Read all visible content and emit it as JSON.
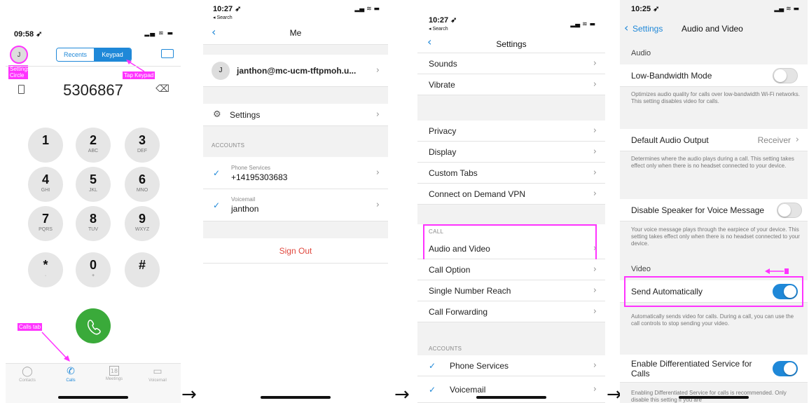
{
  "arrow_glyph": "→",
  "screen1": {
    "time": "09:58 ➶",
    "status_icons": "▂▄ ≋ ▬",
    "avatar_initial": "J",
    "tabs": [
      "Recents",
      "Keypad"
    ],
    "number": "5306867",
    "backspace": "⌫",
    "annotations": {
      "settings_circle": "Settings Circle",
      "tap_keypad": "Tap Keypad",
      "calls_tab": "Calls tab"
    },
    "keys": [
      {
        "d": "1",
        "l": ""
      },
      {
        "d": "2",
        "l": "ABC"
      },
      {
        "d": "3",
        "l": "DEF"
      },
      {
        "d": "4",
        "l": "GHI"
      },
      {
        "d": "5",
        "l": "JKL"
      },
      {
        "d": "6",
        "l": "MNO"
      },
      {
        "d": "7",
        "l": "PQRS"
      },
      {
        "d": "8",
        "l": "TUV"
      },
      {
        "d": "9",
        "l": "WXYZ"
      },
      {
        "d": "*",
        "l": "·"
      },
      {
        "d": "0",
        "l": "+"
      },
      {
        "d": "#",
        "l": ""
      }
    ],
    "bottom_tabs": [
      "Contacts",
      "Calls",
      "Meetings",
      "Voicemail"
    ],
    "meetings_date": "18",
    "colors": {
      "accent": "#1f88d8",
      "call_button": "#3aaa3a",
      "annotation": "#ff33ff"
    }
  },
  "screen2": {
    "time": "10:27 ➶",
    "back_to": "◂ Search",
    "status_icons": "▂▄ ≋ ▬",
    "title": "Me",
    "account_initial": "J",
    "account_email": "janthon@mc-ucm-tftpmoh.u...",
    "settings_label": "Settings",
    "accounts_header": "ACCOUNTS",
    "phone_services_label": "Phone Services",
    "phone_services_value": "+14195303683",
    "voicemail_label": "Voicemail",
    "voicemail_value": "janthon",
    "sign_out": "Sign Out"
  },
  "screen3": {
    "time": "10:27 ➶",
    "back_to": "◂ Search",
    "status_icons": "▂▄ ≋ ▬",
    "title": "Settings",
    "group1": [
      "Sounds",
      "Vibrate"
    ],
    "group2": [
      "Privacy",
      "Display",
      "Custom Tabs",
      "Connect on Demand VPN"
    ],
    "call_header": "CALL",
    "group3": [
      "Audio and Video",
      "Call Option",
      "Single Number Reach",
      "Call Forwarding"
    ],
    "accounts_header": "ACCOUNTS",
    "group4": [
      "Phone Services",
      "Voicemail"
    ]
  },
  "screen4": {
    "time": "10:25 ➶",
    "status_icons": "▂▄ ≋ ▬",
    "back_label": "Settings",
    "title": "Audio and Video",
    "audio_header": "Audio",
    "low_bandwidth": "Low-Bandwidth Mode",
    "low_bandwidth_desc": "Optimizes audio quality for calls over low-bandwidth Wi-Fi networks. This setting disables video for calls.",
    "default_output": "Default Audio Output",
    "default_output_value": "Receiver",
    "default_output_desc": "Determines where the audio plays during a call. This setting takes effect only when there is no headset connected to your device.",
    "disable_speaker": "Disable Speaker for Voice Message",
    "disable_speaker_desc": "Your voice message plays through the earpiece of your device. This setting takes effect only when there is no headset connected to your device.",
    "video_header": "Video",
    "send_auto": "Send Automatically",
    "send_auto_desc": "Automatically sends video for calls. During a call, you can use the call controls to stop sending your video.",
    "diff_service": "Enable Differentiated Service for Calls",
    "diff_service_desc": "Enabling Differentiated Service for calls is recommended. Only disable this setting if you are",
    "toggles": {
      "low_bandwidth": false,
      "disable_speaker": false,
      "send_auto": true,
      "diff_service": true
    }
  }
}
